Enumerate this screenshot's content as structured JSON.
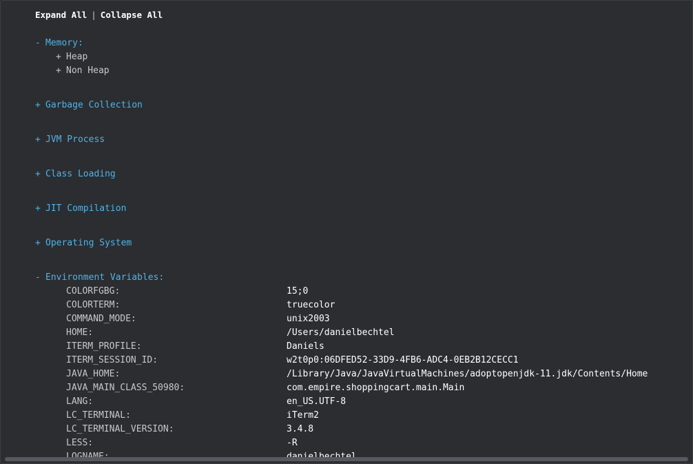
{
  "toolbar": {
    "expand_all": "Expand All",
    "separator": "|",
    "collapse_all": "Collapse All"
  },
  "sections": {
    "memory": {
      "toggle": "-",
      "label": "Memory:"
    },
    "heap": {
      "toggle": "+",
      "label": "Heap"
    },
    "non_heap": {
      "toggle": "+",
      "label": "Non Heap"
    },
    "garbage_collection": {
      "toggle": "+",
      "label": "Garbage Collection"
    },
    "jvm_process": {
      "toggle": "+",
      "label": "JVM Process"
    },
    "class_loading": {
      "toggle": "+",
      "label": "Class Loading"
    },
    "jit_compilation": {
      "toggle": "+",
      "label": "JIT Compilation"
    },
    "operating_system": {
      "toggle": "+",
      "label": "Operating System"
    },
    "environment_variables": {
      "toggle": "-",
      "label": "Environment Variables:"
    }
  },
  "env_vars": [
    {
      "key": "COLORFGBG:",
      "value": "15;0"
    },
    {
      "key": "COLORTERM:",
      "value": "truecolor"
    },
    {
      "key": "COMMAND_MODE:",
      "value": "unix2003"
    },
    {
      "key": "HOME:",
      "value": "/Users/danielbechtel"
    },
    {
      "key": "ITERM_PROFILE:",
      "value": "Daniels"
    },
    {
      "key": "ITERM_SESSION_ID:",
      "value": "w2t0p0:06DFED52-33D9-4FB6-ADC4-0EB2B12CECC1"
    },
    {
      "key": "JAVA_HOME:",
      "value": "/Library/Java/JavaVirtualMachines/adoptopenjdk-11.jdk/Contents/Home"
    },
    {
      "key": "JAVA_MAIN_CLASS_50980:",
      "value": "com.empire.shoppingcart.main.Main"
    },
    {
      "key": "LANG:",
      "value": "en_US.UTF-8"
    },
    {
      "key": "LC_TERMINAL:",
      "value": "iTerm2"
    },
    {
      "key": "LC_TERMINAL_VERSION:",
      "value": "3.4.8"
    },
    {
      "key": "LESS:",
      "value": "-R"
    },
    {
      "key": "LOGNAME:",
      "value": "danielbechtel"
    }
  ],
  "colors": {
    "background": "#2b2d31",
    "section_link": "#4fb3e8",
    "key_text": "#c8c8c8",
    "value_text": "#ffffff"
  }
}
